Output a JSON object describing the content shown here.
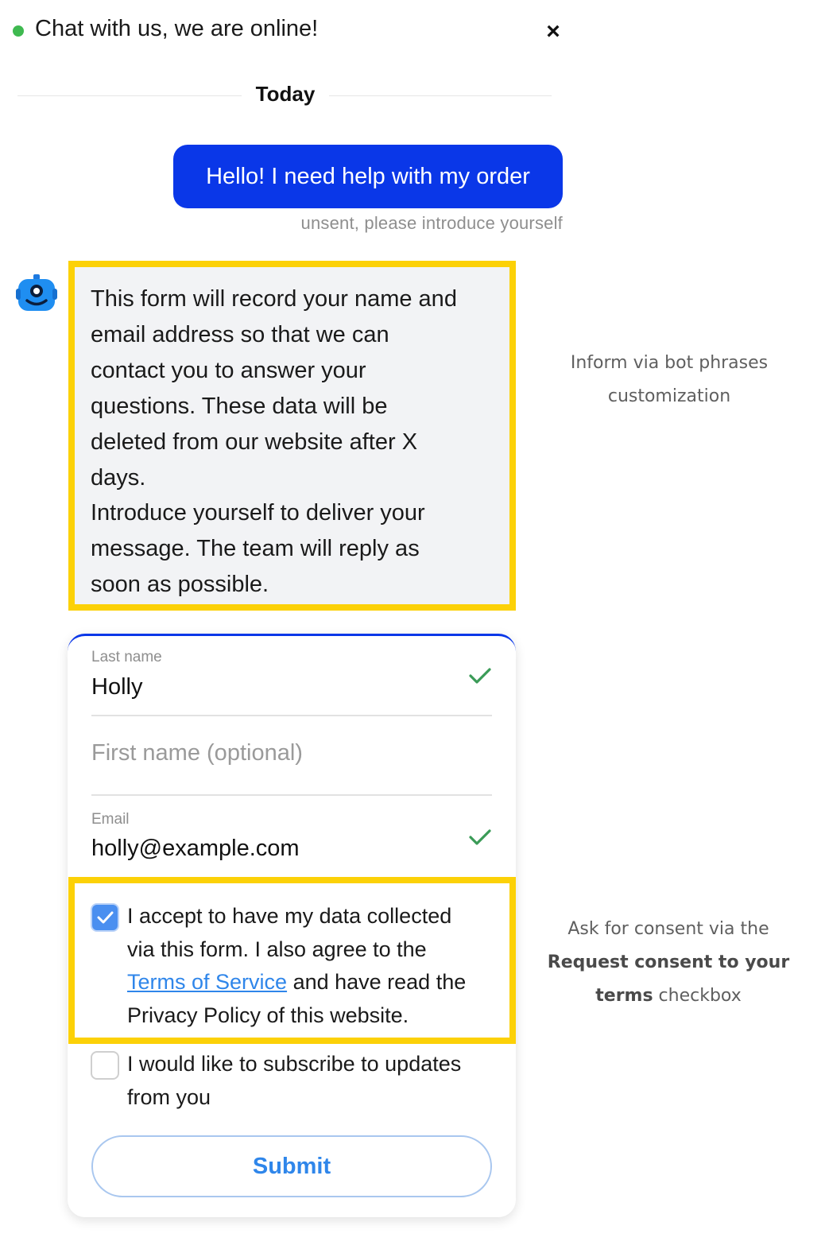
{
  "header": {
    "title": "Chat with us, we are online!",
    "close_label": "×",
    "status_color": "#3fb950"
  },
  "divider": {
    "label": "Today"
  },
  "user_message": {
    "text": "Hello! I need help with my order",
    "status": "unsent, please introduce yourself"
  },
  "bot": {
    "avatar_icon": "robot-icon",
    "info_lines": [
      "This form will record your name and",
      "email address so that we can",
      "contact you to answer your",
      "questions. These data will be",
      "deleted from our website after X",
      "days.",
      "Introduce yourself to deliver your",
      "message. The team will reply as",
      "soon as possible."
    ]
  },
  "annotations": {
    "first_line1": "Inform via bot phrases",
    "first_line2": "customization",
    "second_line1": "Ask for consent via the",
    "second_bold1": "Request consent to your",
    "second_bold2": "terms",
    "second_tail": " checkbox"
  },
  "form": {
    "last_name": {
      "label": "Last name",
      "value": "Holly"
    },
    "first_name": {
      "placeholder": "First name (optional)"
    },
    "email": {
      "label": "Email",
      "value": "holly@example.com"
    },
    "consent": {
      "line1": "I accept to have my data collected",
      "line2": "via this form. I also agree to the",
      "link": "Terms of Service",
      "after_link": " and have read the",
      "line4": "Privacy Policy of this website.",
      "checked": true
    },
    "subscribe": {
      "line1": "I would like to subscribe to updates",
      "line2": "from you",
      "checked": false
    },
    "submit_label": "Submit"
  },
  "colors": {
    "accent": "#0a37e8",
    "highlight": "#fcd107",
    "link": "#2f86ea",
    "check": "#3a9b57"
  }
}
